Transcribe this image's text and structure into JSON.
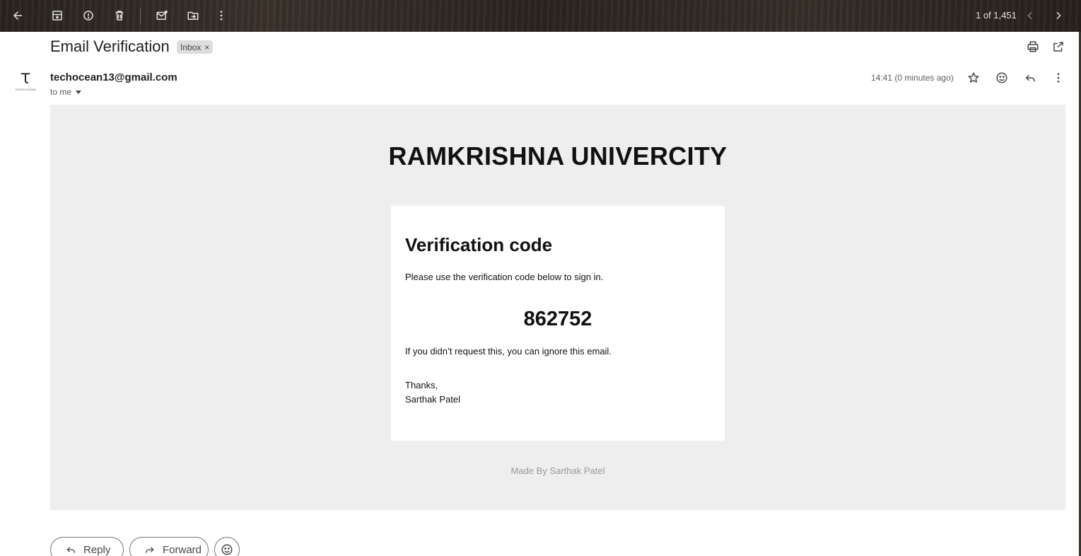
{
  "toolbar": {
    "back": "back-arrow-icon",
    "archive": "archive-icon",
    "report_spam": "report-spam-icon",
    "delete": "trash-icon",
    "mark_unread": "mark-unread-icon",
    "move_to": "move-to-icon",
    "more": "more-vert-icon",
    "count": "1 of 1,451",
    "older": "chevron-left-icon",
    "newer": "chevron-right-icon"
  },
  "email": {
    "subject": "Email Verification",
    "label": "Inbox",
    "label_remove": "×",
    "sender": "techocean13@gmail.com",
    "to": "to me",
    "time": "14:41 (0 minutes ago)",
    "avatar_monogram": "Ꚍ",
    "avatar_text": "TECHO OCEAN"
  },
  "body": {
    "university": "RAMKRISHNA UNIVERCITY",
    "heading": "Verification code",
    "instruction": "Please use the verification code below to sign in.",
    "code": "862752",
    "ignore_note": "If you didn’t request this, you can ignore this email.",
    "thanks": "Thanks,",
    "signature": "Sarthak Patel",
    "footer": "Made By Sarthak Patel"
  },
  "actions": {
    "reply": "Reply",
    "forward": "Forward"
  },
  "colors": {
    "body_bg": "#eeeeee",
    "card_bg": "#ffffff",
    "footer_text": "#999999"
  }
}
